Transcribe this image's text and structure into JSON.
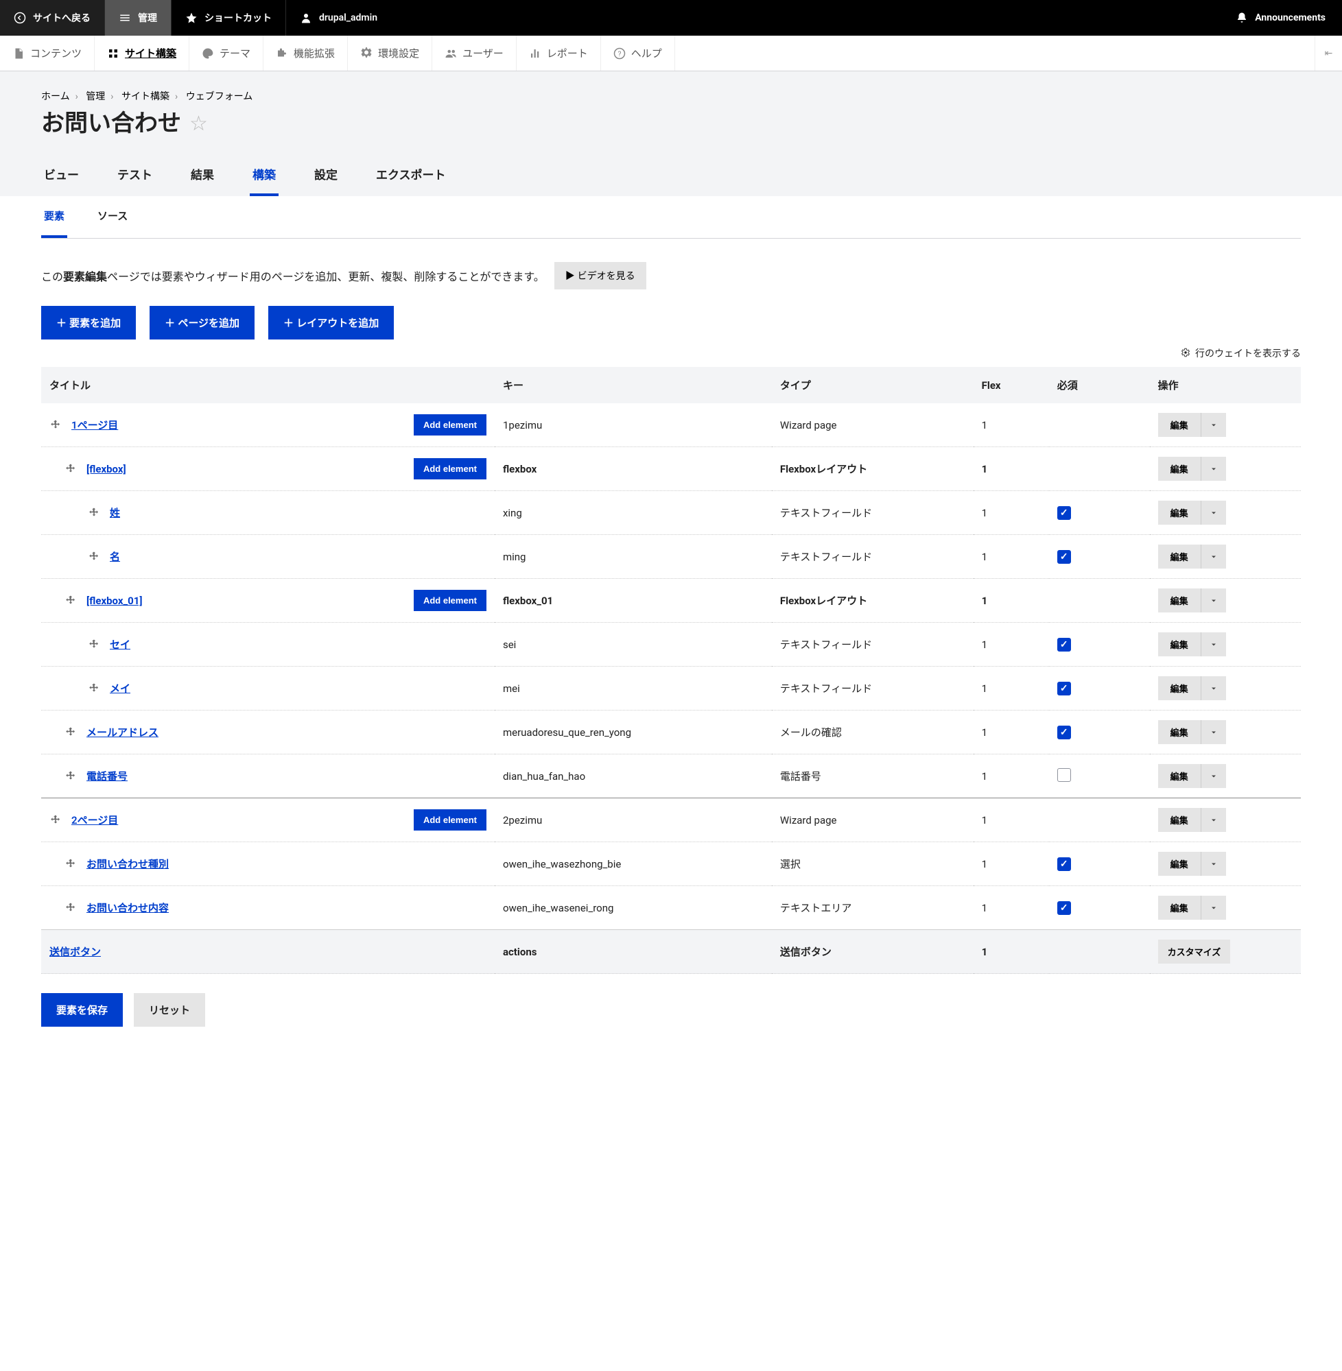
{
  "toolbar": {
    "back": "サイトへ戻る",
    "manage": "管理",
    "shortcuts": "ショートカット",
    "user": "drupal_admin",
    "announcements": "Announcements"
  },
  "admin_menu": {
    "content": "コンテンツ",
    "structure": "サイト構築",
    "appearance": "テーマ",
    "extend": "機能拡張",
    "config": "環境設定",
    "people": "ユーザー",
    "reports": "レポート",
    "help": "ヘルプ"
  },
  "breadcrumb": {
    "home": "ホーム",
    "manage": "管理",
    "structure": "サイト構築",
    "webform": "ウェブフォーム"
  },
  "page": {
    "title": "お問い合わせ",
    "help_pre": "この",
    "help_strong": "要素編集",
    "help_post": "ページでは要素やウィザード用のページを追加、更新、複製、削除することができます。",
    "video_btn": "▶ ビデオを見る",
    "weights_toggle": "行のウェイトを表示する"
  },
  "primary_tabs": {
    "view": "ビュー",
    "test": "テスト",
    "results": "結果",
    "build": "構築",
    "settings": "設定",
    "export": "エクスポート"
  },
  "secondary_tabs": {
    "elements": "要素",
    "source": "ソース"
  },
  "actions": {
    "add_element": "＋ 要素を追加",
    "add_page": "＋ ページを追加",
    "add_layout": "＋ レイアウトを追加"
  },
  "columns": {
    "title": "タイトル",
    "key": "キー",
    "type": "タイプ",
    "flex": "Flex",
    "required": "必須",
    "ops": "操作"
  },
  "labels": {
    "add_element": "Add element",
    "edit": "編集",
    "customize": "カスタマイズ",
    "save": "要素を保存",
    "reset": "リセット"
  },
  "rows": {
    "r0": {
      "title": "1ページ目",
      "key": "1pezimu",
      "type": "Wizard page",
      "flex": "1"
    },
    "r1": {
      "title": "[flexbox]",
      "key": "flexbox",
      "type": "Flexboxレイアウト",
      "flex": "1"
    },
    "r2": {
      "title": "姓",
      "key": "xing",
      "type": "テキストフィールド",
      "flex": "1"
    },
    "r3": {
      "title": "名",
      "key": "ming",
      "type": "テキストフィールド",
      "flex": "1"
    },
    "r4": {
      "title": "[flexbox_01]",
      "key": "flexbox_01",
      "type": "Flexboxレイアウト",
      "flex": "1"
    },
    "r5": {
      "title": "セイ",
      "key": "sei",
      "type": "テキストフィールド",
      "flex": "1"
    },
    "r6": {
      "title": "メイ",
      "key": "mei",
      "type": "テキストフィールド",
      "flex": "1"
    },
    "r7": {
      "title": "メールアドレス",
      "key": "meruadoresu_que_ren_yong",
      "type": "メールの確認",
      "flex": "1"
    },
    "r8": {
      "title": "電話番号",
      "key": "dian_hua_fan_hao",
      "type": "電話番号",
      "flex": "1"
    },
    "r9": {
      "title": "2ページ目",
      "key": "2pezimu",
      "type": "Wizard page",
      "flex": "1"
    },
    "r10": {
      "title": "お問い合わせ種別",
      "key": "owen_ihe_wasezhong_bie",
      "type": "選択",
      "flex": "1"
    },
    "r11": {
      "title": "お問い合わせ内容",
      "key": "owen_ihe_wasenei_rong",
      "type": "テキストエリア",
      "flex": "1"
    },
    "r12": {
      "title": "送信ボタン",
      "key": "actions",
      "type": "送信ボタン",
      "flex": "1"
    }
  }
}
